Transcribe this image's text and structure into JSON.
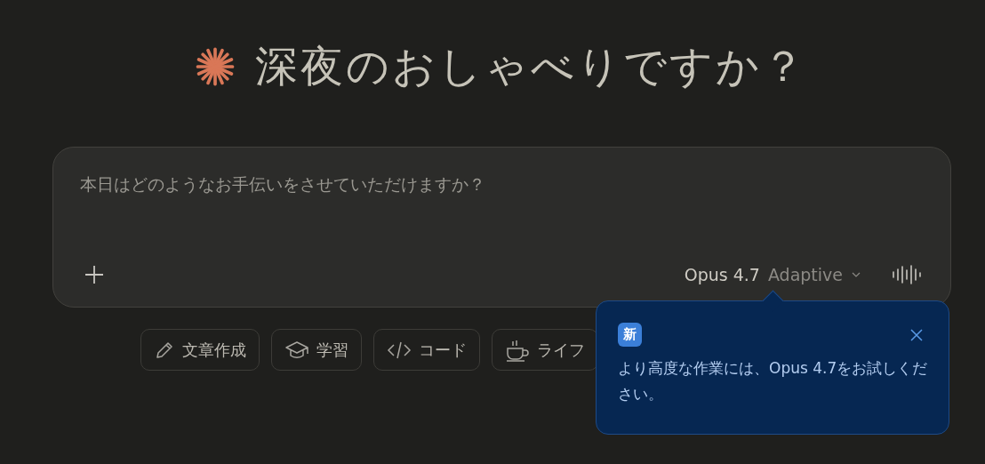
{
  "greeting": "深夜のおしゃべりですか？",
  "composer": {
    "placeholder": "本日はどのようなお手伝いをさせていただけますか？",
    "model": "Opus 4.7",
    "mode": "Adaptive"
  },
  "chips": [
    {
      "kind": "pencil",
      "label": "文章作成"
    },
    {
      "kind": "cap",
      "label": "学習"
    },
    {
      "kind": "code",
      "label": "コード"
    },
    {
      "kind": "cup",
      "label": "ライフ"
    }
  ],
  "popover": {
    "badge": "新",
    "message": "より高度な作業には、Opus 4.7をお試しください。"
  }
}
